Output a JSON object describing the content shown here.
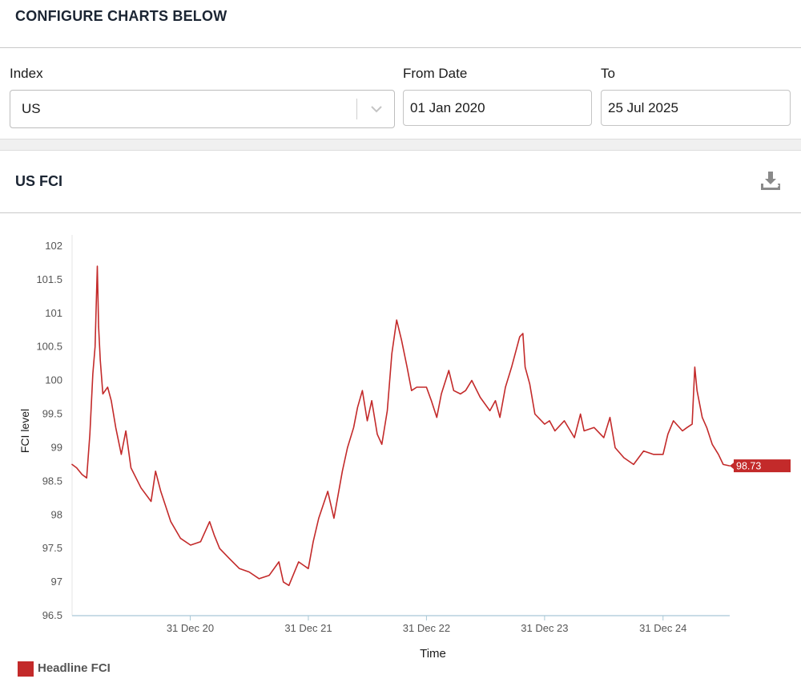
{
  "config": {
    "title": "CONFIGURE CHARTS BELOW",
    "index_label": "Index",
    "index_value": "US",
    "from_label": "From Date",
    "from_value": "01 Jan 2020",
    "to_label": "To",
    "to_value": "25 Jul 2025"
  },
  "chart_panel": {
    "title": "US FCI",
    "download_icon": "download-icon"
  },
  "colors": {
    "series": "#c32a2a",
    "axis": "#a9c8d6",
    "tick_text": "#555555",
    "title_text": "#1b2533"
  },
  "chart_data": {
    "type": "line",
    "xlabel": "Time",
    "ylabel": "FCI level",
    "ylim": [
      96.5,
      102
    ],
    "yticks": [
      96.5,
      97,
      97.5,
      98,
      98.5,
      99,
      99.5,
      100,
      100.5,
      101,
      101.5,
      102
    ],
    "xlim": [
      "2020-01-01",
      "2025-07-25"
    ],
    "xticks": [
      {
        "date": "2020-12-31",
        "label": "31 Dec 20"
      },
      {
        "date": "2021-12-31",
        "label": "31 Dec 21"
      },
      {
        "date": "2022-12-31",
        "label": "31 Dec 22"
      },
      {
        "date": "2023-12-31",
        "label": "31 Dec 23"
      },
      {
        "date": "2024-12-31",
        "label": "31 Dec 24"
      }
    ],
    "last_value_label": "98.73",
    "grid": false,
    "legend": "bottom-left",
    "series": [
      {
        "name": "Headline FCI",
        "points": [
          [
            "2020-01-01",
            98.75
          ],
          [
            "2020-01-15",
            98.7
          ],
          [
            "2020-02-01",
            98.6
          ],
          [
            "2020-02-15",
            98.55
          ],
          [
            "2020-02-25",
            99.2
          ],
          [
            "2020-03-05",
            100.1
          ],
          [
            "2020-03-12",
            100.5
          ],
          [
            "2020-03-16",
            101.2
          ],
          [
            "2020-03-19",
            101.7
          ],
          [
            "2020-03-23",
            100.8
          ],
          [
            "2020-03-28",
            100.3
          ],
          [
            "2020-04-05",
            99.8
          ],
          [
            "2020-04-20",
            99.9
          ],
          [
            "2020-05-01",
            99.7
          ],
          [
            "2020-05-15",
            99.3
          ],
          [
            "2020-06-01",
            98.9
          ],
          [
            "2020-06-15",
            99.25
          ],
          [
            "2020-07-01",
            98.7
          ],
          [
            "2020-08-01",
            98.4
          ],
          [
            "2020-09-01",
            98.2
          ],
          [
            "2020-09-15",
            98.65
          ],
          [
            "2020-10-01",
            98.35
          ],
          [
            "2020-11-01",
            97.9
          ],
          [
            "2020-12-01",
            97.65
          ],
          [
            "2021-01-01",
            97.55
          ],
          [
            "2021-02-01",
            97.6
          ],
          [
            "2021-03-01",
            97.9
          ],
          [
            "2021-03-15",
            97.7
          ],
          [
            "2021-04-01",
            97.5
          ],
          [
            "2021-05-01",
            97.35
          ],
          [
            "2021-06-01",
            97.2
          ],
          [
            "2021-07-01",
            97.15
          ],
          [
            "2021-08-01",
            97.05
          ],
          [
            "2021-09-01",
            97.1
          ],
          [
            "2021-10-01",
            97.3
          ],
          [
            "2021-10-15",
            97.0
          ],
          [
            "2021-11-01",
            96.95
          ],
          [
            "2021-12-01",
            97.3
          ],
          [
            "2021-12-31",
            97.2
          ],
          [
            "2022-01-15",
            97.6
          ],
          [
            "2022-02-01",
            97.95
          ],
          [
            "2022-03-01",
            98.35
          ],
          [
            "2022-03-20",
            97.95
          ],
          [
            "2022-04-15",
            98.65
          ],
          [
            "2022-05-01",
            99.0
          ],
          [
            "2022-05-20",
            99.3
          ],
          [
            "2022-06-01",
            99.6
          ],
          [
            "2022-06-16",
            99.85
          ],
          [
            "2022-07-01",
            99.4
          ],
          [
            "2022-07-15",
            99.7
          ],
          [
            "2022-08-01",
            99.2
          ],
          [
            "2022-08-15",
            99.05
          ],
          [
            "2022-09-01",
            99.55
          ],
          [
            "2022-09-15",
            100.4
          ],
          [
            "2022-09-30",
            100.9
          ],
          [
            "2022-10-15",
            100.6
          ],
          [
            "2022-11-01",
            100.2
          ],
          [
            "2022-11-15",
            99.85
          ],
          [
            "2022-12-01",
            99.9
          ],
          [
            "2022-12-31",
            99.9
          ],
          [
            "2023-01-15",
            99.7
          ],
          [
            "2023-02-01",
            99.45
          ],
          [
            "2023-02-15",
            99.8
          ],
          [
            "2023-03-10",
            100.15
          ],
          [
            "2023-03-25",
            99.85
          ],
          [
            "2023-04-15",
            99.8
          ],
          [
            "2023-05-01",
            99.85
          ],
          [
            "2023-05-20",
            100.0
          ],
          [
            "2023-06-15",
            99.75
          ],
          [
            "2023-07-15",
            99.55
          ],
          [
            "2023-08-01",
            99.7
          ],
          [
            "2023-08-15",
            99.45
          ],
          [
            "2023-09-01",
            99.9
          ],
          [
            "2023-09-20",
            100.2
          ],
          [
            "2023-10-15",
            100.65
          ],
          [
            "2023-10-25",
            100.7
          ],
          [
            "2023-11-01",
            100.2
          ],
          [
            "2023-11-15",
            99.95
          ],
          [
            "2023-12-01",
            99.5
          ],
          [
            "2023-12-31",
            99.35
          ],
          [
            "2024-01-15",
            99.4
          ],
          [
            "2024-02-01",
            99.25
          ],
          [
            "2024-03-01",
            99.4
          ],
          [
            "2024-04-01",
            99.15
          ],
          [
            "2024-04-20",
            99.5
          ],
          [
            "2024-05-01",
            99.25
          ],
          [
            "2024-06-01",
            99.3
          ],
          [
            "2024-07-01",
            99.15
          ],
          [
            "2024-07-20",
            99.45
          ],
          [
            "2024-08-05",
            99.0
          ],
          [
            "2024-09-01",
            98.85
          ],
          [
            "2024-10-01",
            98.75
          ],
          [
            "2024-11-01",
            98.95
          ],
          [
            "2024-12-01",
            98.9
          ],
          [
            "2024-12-31",
            98.9
          ],
          [
            "2025-01-15",
            99.2
          ],
          [
            "2025-02-01",
            99.4
          ],
          [
            "2025-03-01",
            99.25
          ],
          [
            "2025-03-15",
            99.3
          ],
          [
            "2025-03-31",
            99.35
          ],
          [
            "2025-04-08",
            100.2
          ],
          [
            "2025-04-15",
            99.85
          ],
          [
            "2025-05-01",
            99.45
          ],
          [
            "2025-05-15",
            99.3
          ],
          [
            "2025-06-01",
            99.05
          ],
          [
            "2025-06-20",
            98.9
          ],
          [
            "2025-07-05",
            98.75
          ],
          [
            "2025-07-25",
            98.73
          ]
        ]
      }
    ]
  }
}
